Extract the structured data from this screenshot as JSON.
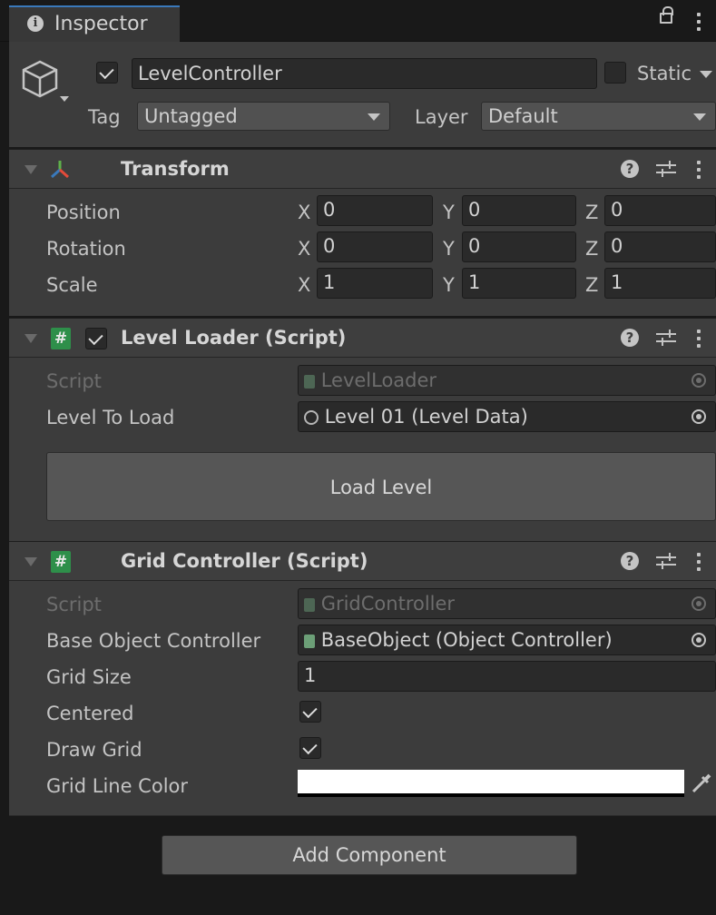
{
  "tab": {
    "title": "Inspector"
  },
  "header": {
    "object_name": "LevelController",
    "static_label": "Static",
    "tag_label": "Tag",
    "tag_value": "Untagged",
    "layer_label": "Layer",
    "layer_value": "Default"
  },
  "transform": {
    "title": "Transform",
    "rows": [
      {
        "label": "Position",
        "x": "0",
        "y": "0",
        "z": "0"
      },
      {
        "label": "Rotation",
        "x": "0",
        "y": "0",
        "z": "0"
      },
      {
        "label": "Scale",
        "x": "1",
        "y": "1",
        "z": "1"
      }
    ],
    "axis_x": "X",
    "axis_y": "Y",
    "axis_z": "Z"
  },
  "level_loader": {
    "title": "Level Loader (Script)",
    "script_label": "Script",
    "script_value": "LevelLoader",
    "level_label": "Level To Load",
    "level_value": "Level 01 (Level Data)",
    "button_label": "Load Level"
  },
  "grid_controller": {
    "title": "Grid Controller (Script)",
    "script_label": "Script",
    "script_value": "GridController",
    "base_label": "Base Object Controller",
    "base_value": "BaseObject (Object Controller)",
    "grid_size_label": "Grid Size",
    "grid_size_value": "1",
    "centered_label": "Centered",
    "draw_grid_label": "Draw Grid",
    "line_color_label": "Grid Line Color",
    "line_color_value": "#ffffff"
  },
  "add_component_label": "Add Component",
  "colors": {
    "panel": "#3c3c3c",
    "header": "#3e3e3e",
    "field": "#2a2a2a",
    "accent": "#3a79bb",
    "script_green": "#2e8f4a"
  }
}
